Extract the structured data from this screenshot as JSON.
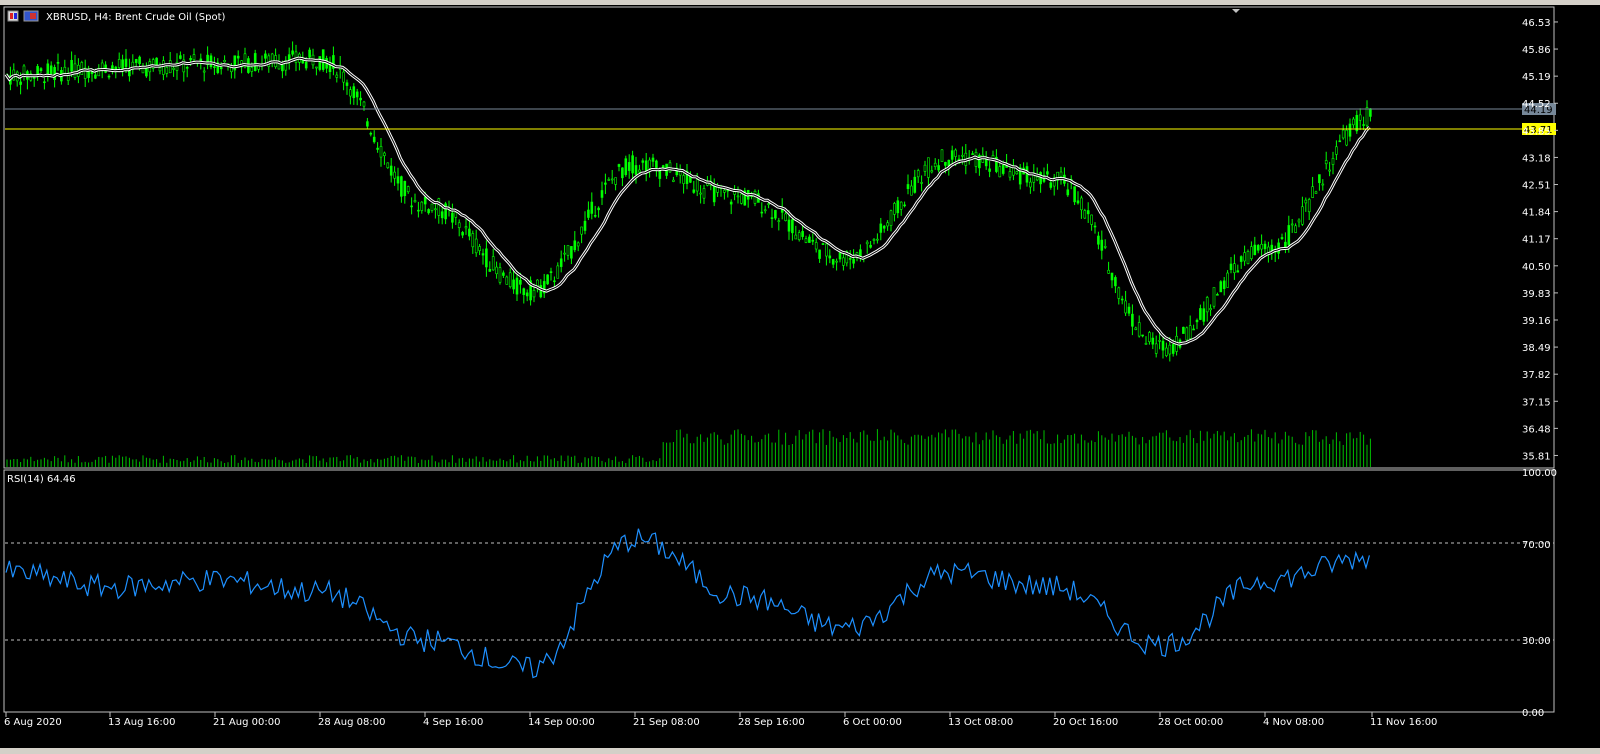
{
  "window": {
    "title": "XBRUSD, H4:  Brent Crude Oil (Spot)"
  },
  "rsi_panel": {
    "title": "RSI(14) 64.46",
    "levels": [
      70,
      30
    ]
  },
  "colors": {
    "background": "#000000",
    "candles": "#00ff00",
    "moving_average": "#ffffff",
    "rsi_line": "#1e90ff",
    "bid_line": "#778899",
    "ask_line": "#ffff00",
    "volume": "#00c000"
  },
  "price_axis": {
    "ticks": [
      "46.53",
      "45.86",
      "45.19",
      "44.52",
      "43.85",
      "43.18",
      "42.51",
      "41.84",
      "41.17",
      "40.50",
      "39.83",
      "39.16",
      "38.49",
      "37.82",
      "37.15",
      "36.48",
      "35.81"
    ],
    "bid_label": "44.19",
    "ask_label": "43.71"
  },
  "rsi_axis": {
    "ticks": [
      "100.00",
      "70.00",
      "30.00",
      "0.00"
    ]
  },
  "time_axis": {
    "labels": [
      "6 Aug 2020",
      "13 Aug 16:00",
      "21 Aug 00:00",
      "28 Aug 08:00",
      "4 Sep 16:00",
      "14 Sep 00:00",
      "21 Sep 08:00",
      "28 Sep 16:00",
      "6 Oct 00:00",
      "13 Oct 08:00",
      "20 Oct 16:00",
      "28 Oct 00:00",
      "4 Nov 08:00",
      "11 Nov 16:00"
    ]
  },
  "chart_data": {
    "type": "line",
    "title": "XBRUSD, H4:  Brent Crude Oil (Spot)",
    "x": [
      "6 Aug 2020",
      "13 Aug 16:00",
      "21 Aug 00:00",
      "28 Aug 08:00",
      "4 Sep 16:00",
      "14 Sep 00:00",
      "21 Sep 08:00",
      "28 Sep 16:00",
      "6 Oct 00:00",
      "13 Oct 08:00",
      "20 Oct 16:00",
      "28 Oct 00:00",
      "4 Nov 08:00",
      "11 Nov 16:00"
    ],
    "series": [
      {
        "values": [
          45.2,
          45.4,
          45.5,
          45.6,
          42.0,
          39.9,
          43.0,
          42.2,
          40.7,
          43.2,
          42.6,
          38.5,
          40.9,
          44.2
        ]
      }
    ],
    "ylim": [
      35.5,
      46.9
    ],
    "rsi_values": [
      58,
      52,
      55,
      50,
      30,
      18,
      72,
      48,
      35,
      58,
      52,
      28,
      55,
      64.46
    ],
    "rsi_ylim": [
      0,
      100
    ]
  }
}
